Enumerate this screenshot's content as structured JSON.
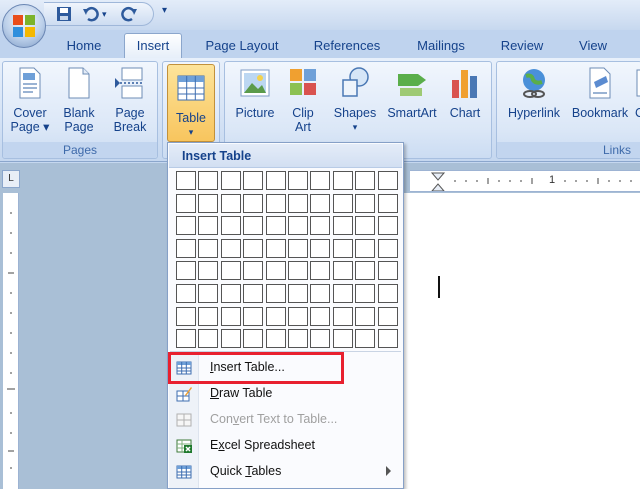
{
  "tabs": [
    "Home",
    "Insert",
    "Page Layout",
    "References",
    "Mailings",
    "Review",
    "View"
  ],
  "active_tab": "Insert",
  "ribbon": {
    "pages_group": {
      "label": "Pages",
      "buttons": [
        {
          "line1": "Cover",
          "line2": "Page ▾",
          "icon": "cover-page-icon"
        },
        {
          "line1": "Blank",
          "line2": "Page",
          "icon": "blank-page-icon"
        },
        {
          "line1": "Page",
          "line2": "Break",
          "icon": "page-break-icon"
        }
      ]
    },
    "tables_group": {
      "button": {
        "line1": "Table",
        "line2": "▾",
        "icon": "table-icon"
      }
    },
    "illustrations_group": {
      "buttons": [
        {
          "line1": "Picture",
          "line2": "",
          "icon": "picture-icon"
        },
        {
          "line1": "Clip",
          "line2": "Art",
          "icon": "clip-art-icon"
        },
        {
          "line1": "Shapes",
          "line2": "▾",
          "icon": "shapes-icon"
        },
        {
          "line1": "SmartArt",
          "line2": "",
          "icon": "smartart-icon"
        },
        {
          "line1": "Chart",
          "line2": "",
          "icon": "chart-icon"
        }
      ]
    },
    "links_group": {
      "label": "Links",
      "buttons": [
        {
          "line1": "Hyperlink",
          "line2": "",
          "icon": "hyperlink-icon"
        },
        {
          "line1": "Bookmark",
          "line2": "",
          "icon": "bookmark-icon"
        },
        {
          "line1": "C",
          "line2": "",
          "icon": "cross-reference-icon"
        }
      ]
    }
  },
  "ruler": {
    "tick_label": "1",
    "corner": "L"
  },
  "dropdown": {
    "title": "Insert Table",
    "grid_cols": 10,
    "grid_rows": 8,
    "items": [
      {
        "label": "Insert Table...",
        "icon": "insert-table-icon",
        "enabled": true,
        "submenu": false,
        "highlighted": true
      },
      {
        "label": "Draw Table",
        "icon": "draw-table-icon",
        "enabled": true,
        "submenu": false,
        "highlighted": false
      },
      {
        "label": "Convert Text to Table...",
        "icon": "convert-text-to-table-icon",
        "enabled": false,
        "submenu": false,
        "highlighted": false
      },
      {
        "label": "Excel Spreadsheet",
        "icon": "excel-spreadsheet-icon",
        "enabled": true,
        "submenu": false,
        "highlighted": false
      },
      {
        "label": "Quick Tables",
        "icon": "quick-tables-icon",
        "enabled": true,
        "submenu": true,
        "highlighted": false
      }
    ]
  },
  "colors": {
    "ribbon_text": "#15428b",
    "highlight": "#e8202f",
    "pressed": "#f8c55e"
  }
}
